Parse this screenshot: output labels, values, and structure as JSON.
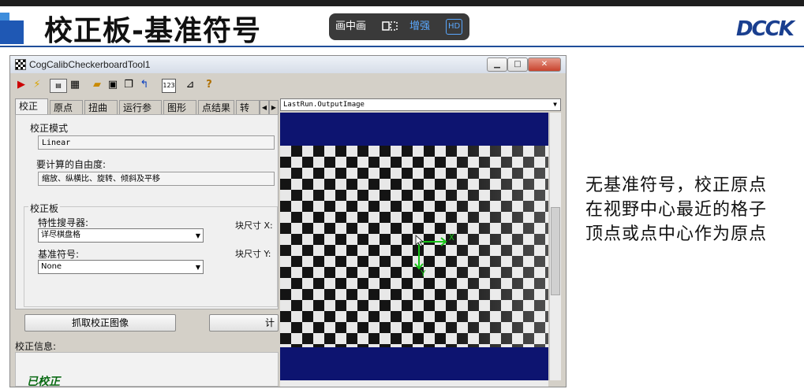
{
  "slide": {
    "title": "校正板-基准符号",
    "logo": "DCCK",
    "description": "无基准符号，校正原点在视野中心最近的格子顶点或点中心作为原点"
  },
  "video_controls": {
    "pip": "画中画",
    "enhance": "增强",
    "hd": "HD"
  },
  "window": {
    "title": "CogCalibCheckerboardTool1",
    "min": "▁",
    "max": "□",
    "close": "✕"
  },
  "tabs": [
    {
      "label": "校正",
      "active": true
    },
    {
      "label": "原点"
    },
    {
      "label": "扭曲"
    },
    {
      "label": "运行参数"
    },
    {
      "label": "图形"
    },
    {
      "label": "点结果"
    },
    {
      "label": "转拉"
    }
  ],
  "form": {
    "calib_mode_label": "校正模式",
    "calib_mode_value": "Linear",
    "dof_label": "要计算的自由度:",
    "dof_value": "缩放、纵横比、旋转、倾斜及平移",
    "board_label": "校正板",
    "feature_finder_label": "特性搜寻器:",
    "feature_finder_value": "详尽棋盘格",
    "fiducial_label": "基准符号:",
    "fiducial_value": "None",
    "tile_x_label": "块尺寸 X:",
    "tile_y_label": "块尺寸 Y:",
    "grab_button": "抓取校正图像",
    "compute_button": "计",
    "info_label": "校正信息:",
    "status_text": "已校正"
  },
  "display": {
    "image_select": "LastRun.OutputImage",
    "axis_x": "X",
    "axis_y": "Y"
  },
  "colors": {
    "background_display": "#0d1470",
    "axis_green": "#19c419",
    "title_rule": "#1f4e9a"
  }
}
